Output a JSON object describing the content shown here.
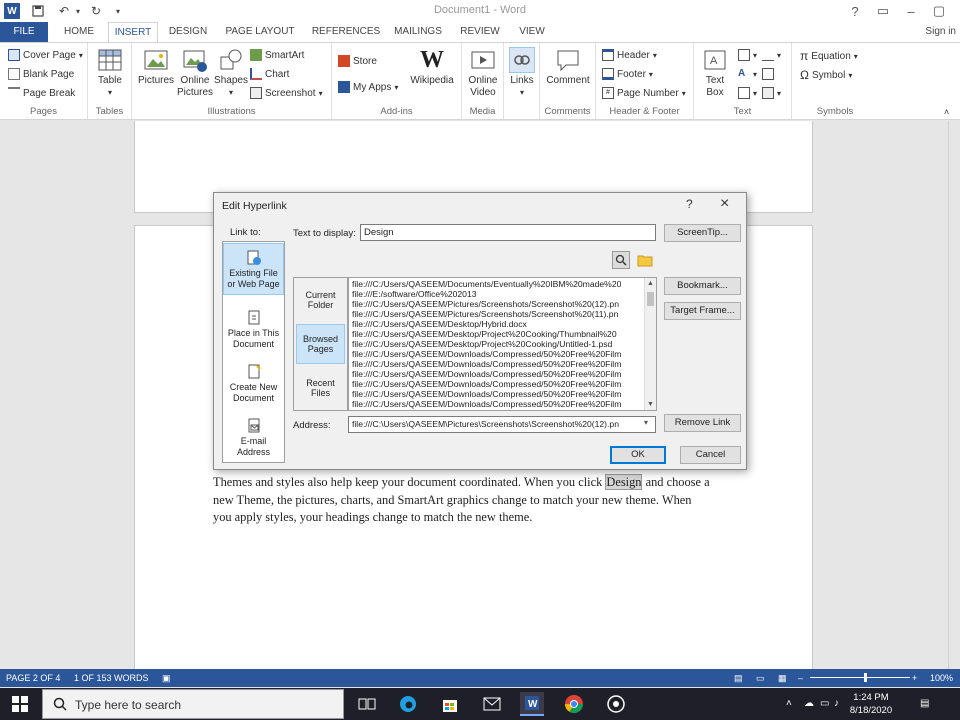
{
  "titlebar": {
    "document_title": "Document1 - Word"
  },
  "tabs": {
    "file": "FILE",
    "items": [
      "HOME",
      "INSERT",
      "DESIGN",
      "PAGE LAYOUT",
      "REFERENCES",
      "MAILINGS",
      "REVIEW",
      "VIEW"
    ],
    "active": "INSERT",
    "sign_in": "Sign in"
  },
  "ribbon": {
    "pages": {
      "label": "Pages",
      "cover_page": "Cover Page",
      "blank_page": "Blank Page",
      "page_break": "Page Break"
    },
    "tables": {
      "label": "Tables",
      "table": "Table"
    },
    "illustrations": {
      "label": "Illustrations",
      "pictures": "Pictures",
      "online_pictures_1": "Online",
      "online_pictures_2": "Pictures",
      "shapes": "Shapes",
      "smartart": "SmartArt",
      "chart": "Chart",
      "screenshot": "Screenshot"
    },
    "addins": {
      "label": "Add-ins",
      "store": "Store",
      "my_apps": "My Apps",
      "wikipedia": "Wikipedia"
    },
    "media": {
      "label": "Media",
      "online_video_1": "Online",
      "online_video_2": "Video"
    },
    "links": {
      "label": "",
      "links": "Links"
    },
    "comments": {
      "label": "Comments",
      "comment": "Comment"
    },
    "header_footer": {
      "label": "Header & Footer",
      "header": "Header",
      "footer": "Footer",
      "page_number": "Page Number"
    },
    "text": {
      "label": "Text",
      "text_box_1": "Text",
      "text_box_2": "Box"
    },
    "symbols": {
      "label": "Symbols",
      "equation": "Equation",
      "symbol": "Symbol"
    }
  },
  "dialog": {
    "title": "Edit Hyperlink",
    "help": "?",
    "link_to_label": "Link to:",
    "link_to_items": [
      {
        "line1": "Existing File",
        "line2": "or Web Page"
      },
      {
        "line1": "Place in This",
        "line2": "Document"
      },
      {
        "line1": "Create New",
        "line2": "Document"
      },
      {
        "line1": "E-mail",
        "line2": "Address"
      }
    ],
    "text_to_display_label": "Text to display:",
    "text_to_display_value": "Design",
    "screentip_button": "ScreenTip...",
    "look_in_items": [
      {
        "line1": "Current",
        "line2": "Folder"
      },
      {
        "line1": "Browsed",
        "line2": "Pages"
      },
      {
        "line1": "Recent",
        "line2": "Files"
      }
    ],
    "files": [
      "file:///C:/Users/QASEEM/Documents/Eventually%20IBM%20made%20",
      "file:///E:/software/Office%202013",
      "file:///C:/Users/QASEEM/Pictures/Screenshots/Screenshot%20(12).pn",
      "file:///C:/Users/QASEEM/Pictures/Screenshots/Screenshot%20(11).pn",
      "file:///C:/Users/QASEEM/Desktop/Hybrid.docx",
      "file:///C:/Users/QASEEM/Desktop/Project%20Cooking/Thumbnail%20",
      "file:///C:/Users/QASEEM/Desktop/Project%20Cooking/Untitled-1.psd",
      "file:///C:/Users/QASEEM/Downloads/Compressed/50%20Free%20Film",
      "file:///C:/Users/QASEEM/Downloads/Compressed/50%20Free%20Film",
      "file:///C:/Users/QASEEM/Downloads/Compressed/50%20Free%20Film",
      "file:///C:/Users/QASEEM/Downloads/Compressed/50%20Free%20Film",
      "file:///C:/Users/QASEEM/Downloads/Compressed/50%20Free%20Film",
      "file:///C:/Users/QASEEM/Downloads/Compressed/50%20Free%20Film"
    ],
    "bookmark_button": "Bookmark...",
    "target_frame_button": "Target Frame...",
    "address_label": "Address:",
    "address_value": "file:///C:\\Users\\QASEEM\\Pictures\\Screenshots\\Screenshot%20(12).pn",
    "remove_link_button": "Remove Link",
    "ok_button": "OK",
    "cancel_button": "Cancel"
  },
  "document": {
    "text_before": "Themes and styles also help keep your document coordinated. When you click ",
    "hyperlink_word": "Design",
    "text_after": " and choose a new Theme, the pictures, charts, and SmartArt graphics change to match your new theme. When you apply styles, your headings change to match the new theme."
  },
  "statusbar": {
    "page": "PAGE 2 OF 4",
    "words": "1 OF 153 WORDS",
    "zoom": "100%"
  },
  "taskbar": {
    "search_placeholder": "Type here to search",
    "time": "1:24 PM",
    "date": "8/18/2020"
  },
  "colors": {
    "word_blue": "#2b579a",
    "taskbar": "#1f1f2a",
    "selection": "#cce4f7"
  }
}
